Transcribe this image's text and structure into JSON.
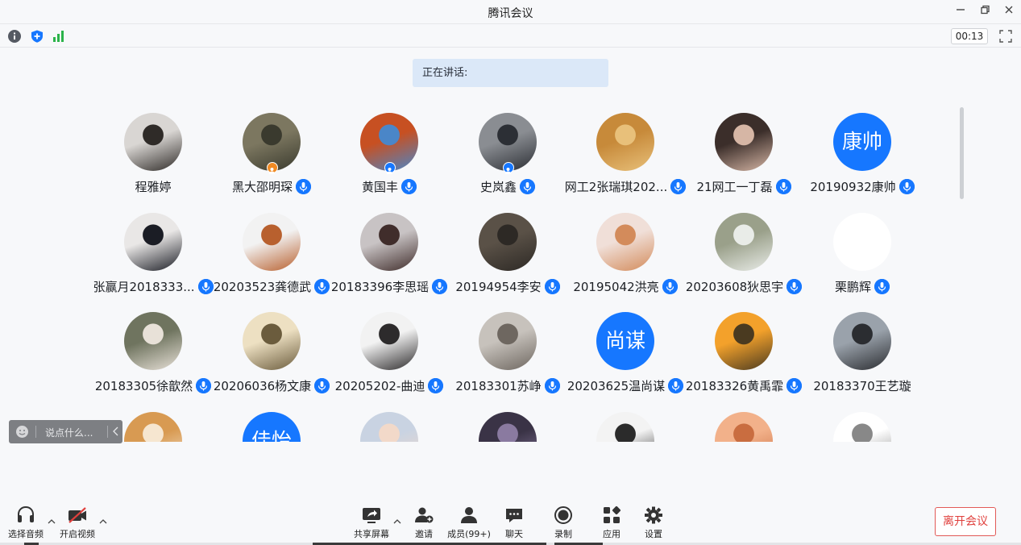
{
  "window": {
    "title": "腾讯会议"
  },
  "status": {
    "timer": "00:13"
  },
  "speaking": {
    "label": "正在讲话:"
  },
  "participants": [
    {
      "name": "程雅婷",
      "avatar_type": "photo",
      "photo_colors": [
        "#d9d6d3",
        "#2f2b28"
      ],
      "mic": false,
      "badge": ""
    },
    {
      "name": "黑大邵明琛",
      "avatar_type": "photo",
      "photo_colors": [
        "#7c7760",
        "#3a3a2e"
      ],
      "mic": true,
      "badge": "host"
    },
    {
      "name": "黄国丰",
      "avatar_type": "photo",
      "photo_colors": [
        "#c75022",
        "#4a86c8"
      ],
      "mic": true,
      "badge": "cohost"
    },
    {
      "name": "史岚鑫",
      "avatar_type": "photo",
      "photo_colors": [
        "#8a8d92",
        "#2c2f35"
      ],
      "mic": true,
      "badge": "cohost"
    },
    {
      "name": "网工2张瑞琪202...",
      "avatar_type": "photo",
      "photo_colors": [
        "#c78a3a",
        "#e8c07a"
      ],
      "mic": true,
      "badge": ""
    },
    {
      "name": "21网工一丁磊",
      "avatar_type": "photo",
      "photo_colors": [
        "#3b2e2a",
        "#d6b6a5"
      ],
      "mic": true,
      "badge": ""
    },
    {
      "name": "20190932康帅",
      "avatar_type": "text",
      "text": "康帅",
      "mic": true,
      "badge": ""
    },
    {
      "name": "张赢月2018333...",
      "avatar_type": "photo",
      "photo_colors": [
        "#e9e7e6",
        "#1b1d25"
      ],
      "mic": true,
      "badge": ""
    },
    {
      "name": "20203523龚德武",
      "avatar_type": "photo",
      "photo_colors": [
        "#f2f2f2",
        "#b8602e"
      ],
      "mic": true,
      "badge": ""
    },
    {
      "name": "20183396李思瑶",
      "avatar_type": "photo",
      "photo_colors": [
        "#c8c3c4",
        "#402d2b"
      ],
      "mic": true,
      "badge": ""
    },
    {
      "name": "20194954李安",
      "avatar_type": "photo",
      "photo_colors": [
        "#5a5147",
        "#2d2925"
      ],
      "mic": true,
      "badge": ""
    },
    {
      "name": "20195042洪亮",
      "avatar_type": "photo",
      "photo_colors": [
        "#f0dfd8",
        "#d38b5b"
      ],
      "mic": true,
      "badge": ""
    },
    {
      "name": "20203608狄思宇",
      "avatar_type": "photo",
      "photo_colors": [
        "#9aa08a",
        "#e9ece8"
      ],
      "mic": true,
      "badge": ""
    },
    {
      "name": "栗鹏辉",
      "avatar_type": "blank",
      "mic": true,
      "badge": ""
    },
    {
      "name": "20183305徐歆然",
      "avatar_type": "photo",
      "photo_colors": [
        "#6f745f",
        "#e8e1d8"
      ],
      "mic": true,
      "badge": ""
    },
    {
      "name": "20206036杨文康",
      "avatar_type": "photo",
      "photo_colors": [
        "#ede0c2",
        "#6b5c3d"
      ],
      "mic": true,
      "badge": ""
    },
    {
      "name": "20205202-曲迪",
      "avatar_type": "photo",
      "photo_colors": [
        "#f2f2f2",
        "#2d2b2c"
      ],
      "mic": true,
      "badge": ""
    },
    {
      "name": "20183301苏峥",
      "avatar_type": "photo",
      "photo_colors": [
        "#c7c2bc",
        "#6e6760"
      ],
      "mic": true,
      "badge": ""
    },
    {
      "name": "20203625温尚谋",
      "avatar_type": "text",
      "text": "尚谋",
      "mic": true,
      "badge": ""
    },
    {
      "name": "20183326黄禹霏",
      "avatar_type": "photo",
      "photo_colors": [
        "#f3a12b",
        "#4a3a20"
      ],
      "mic": true,
      "badge": ""
    },
    {
      "name": "20183370王艺璇",
      "avatar_type": "photo",
      "photo_colors": [
        "#9aa2ab",
        "#2b2d31"
      ],
      "mic": false,
      "badge": ""
    },
    {
      "name": "",
      "avatar_type": "photo",
      "photo_colors": [
        "#d89a52",
        "#f6e6d0"
      ],
      "mic": false,
      "badge": ""
    },
    {
      "name": "",
      "avatar_type": "text",
      "text": "佳怡",
      "mic": false,
      "badge": ""
    },
    {
      "name": "",
      "avatar_type": "photo",
      "photo_colors": [
        "#c9d3e2",
        "#f2d9c9"
      ],
      "mic": false,
      "badge": ""
    },
    {
      "name": "",
      "avatar_type": "photo",
      "photo_colors": [
        "#3a3346",
        "#8a7aa0"
      ],
      "mic": false,
      "badge": ""
    },
    {
      "name": "",
      "avatar_type": "photo",
      "photo_colors": [
        "#f3f3f3",
        "#2b2b2b"
      ],
      "mic": false,
      "badge": ""
    },
    {
      "name": "",
      "avatar_type": "photo",
      "photo_colors": [
        "#f2b18a",
        "#c96d40"
      ],
      "mic": false,
      "badge": ""
    },
    {
      "name": "",
      "avatar_type": "photo",
      "photo_colors": [
        "#ffffff",
        "#888888"
      ],
      "mic": false,
      "badge": ""
    }
  ],
  "chat": {
    "placeholder": "说点什么..."
  },
  "toolbar": {
    "audio_label": "选择音频",
    "video_label": "开启视频",
    "share_label": "共享屏幕",
    "invite_label": "邀请",
    "members_label": "成员(99+)",
    "chat_label": "聊天",
    "record_label": "录制",
    "apps_label": "应用",
    "settings_label": "设置",
    "leave_label": "离开会议"
  },
  "colors": {
    "accent": "#1677ff",
    "leave": "#e0403d",
    "signal": "#2bb34a",
    "host_badge": "#f08a24",
    "cohost_badge": "#1677ff"
  }
}
